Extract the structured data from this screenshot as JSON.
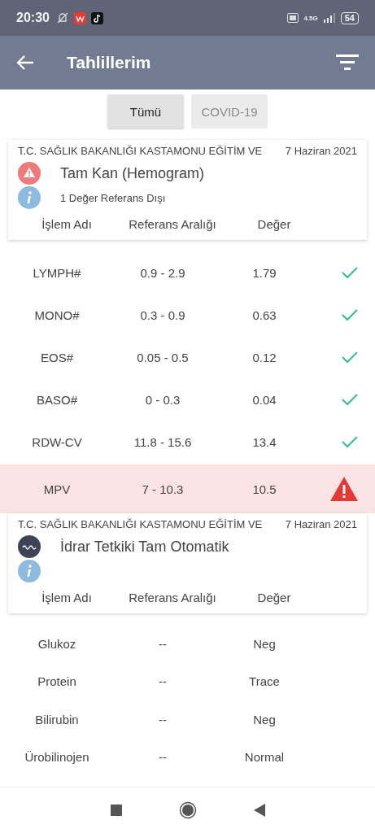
{
  "status_bar": {
    "time": "20:30",
    "network": "4.5G",
    "battery": "54"
  },
  "app_bar": {
    "title": "Tahlillerim"
  },
  "filters": [
    {
      "label": "Tümü",
      "selected": true
    },
    {
      "label": "COVID-19",
      "selected": false
    }
  ],
  "sections": [
    {
      "hospital": "T.C. SAĞLIK BAKANLIĞI KASTAMONU EĞİTİM VE",
      "date": "7 Haziran 2021",
      "title": "Tam Kan (Hemogram)",
      "kind": "warning",
      "note": "1 Değer Referans Dışı",
      "columns": [
        "İşlem Adı",
        "Referans Aralığı",
        "Değer"
      ],
      "rows": [
        {
          "name": "LYMPH#",
          "range": "0.9 - 2.9",
          "value": "1.79",
          "kind": "ok"
        },
        {
          "name": "MONO#",
          "range": "0.3 - 0.9",
          "value": "0.63",
          "kind": "ok"
        },
        {
          "name": "EOS#",
          "range": "0.05 - 0.5",
          "value": "0.12",
          "kind": "ok"
        },
        {
          "name": "BASO#",
          "range": "0 - 0.3",
          "value": "0.04",
          "kind": "ok"
        },
        {
          "name": "RDW-CV",
          "range": "11.8 - 15.6",
          "value": "13.4",
          "kind": "ok"
        },
        {
          "name": "MPV",
          "range": "7 - 10.3",
          "value": "10.5",
          "kind": "alert"
        }
      ]
    },
    {
      "hospital": "T.C. SAĞLIK BAKANLIĞI KASTAMONU EĞİTİM VE",
      "date": "7 Haziran 2021",
      "title": "İdrar Tetkiki Tam Otomatik",
      "kind": "wave",
      "columns": [
        "İşlem Adı",
        "Referans Aralığı",
        "Değer"
      ],
      "rows": [
        {
          "name": "Glukoz",
          "range": "--",
          "value": "Neg",
          "kind": "plain"
        },
        {
          "name": "Protein",
          "range": "--",
          "value": "Trace",
          "kind": "plain"
        },
        {
          "name": "Bilirubin",
          "range": "--",
          "value": "Neg",
          "kind": "plain"
        },
        {
          "name": "Ürobilinojen",
          "range": "--",
          "value": "Normal",
          "kind": "plain"
        }
      ]
    }
  ]
}
